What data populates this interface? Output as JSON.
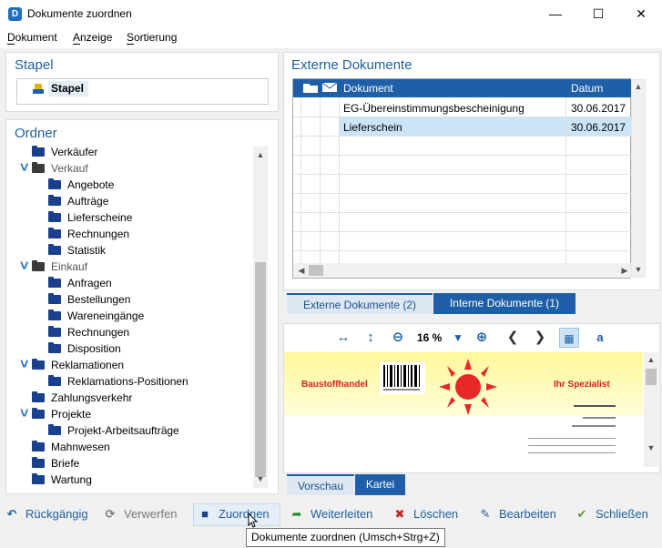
{
  "window": {
    "title": "Dokumente zuordnen",
    "controls": [
      "minimize",
      "maximize",
      "close"
    ]
  },
  "menu": {
    "items": [
      {
        "label": "Dokument",
        "accel": "D"
      },
      {
        "label": "Anzeige",
        "accel": "A"
      },
      {
        "label": "Sortierung",
        "accel": "S"
      }
    ]
  },
  "stapel": {
    "title": "Stapel",
    "item": "Stapel"
  },
  "ordner": {
    "title": "Ordner",
    "items": [
      {
        "label": "Verkäufer",
        "level": 0,
        "expanded": false
      },
      {
        "label": "Verkauf",
        "level": 0,
        "expanded": true,
        "grey": true
      },
      {
        "label": "Angebote",
        "level": 1
      },
      {
        "label": "Aufträge",
        "level": 1
      },
      {
        "label": "Lieferscheine",
        "level": 1
      },
      {
        "label": "Rechnungen",
        "level": 1
      },
      {
        "label": "Statistik",
        "level": 1
      },
      {
        "label": "Einkauf",
        "level": 0,
        "expanded": true,
        "grey": true
      },
      {
        "label": "Anfragen",
        "level": 1
      },
      {
        "label": "Bestellungen",
        "level": 1
      },
      {
        "label": "Wareneingänge",
        "level": 1
      },
      {
        "label": "Rechnungen",
        "level": 1
      },
      {
        "label": "Disposition",
        "level": 1
      },
      {
        "label": "Reklamationen",
        "level": 0,
        "expanded": true
      },
      {
        "label": "Reklamations-Positionen",
        "level": 1
      },
      {
        "label": "Zahlungsverkehr",
        "level": 0
      },
      {
        "label": "Projekte",
        "level": 0,
        "expanded": true
      },
      {
        "label": "Projekt-Arbeitsaufträge",
        "level": 1
      },
      {
        "label": "Mahnwesen",
        "level": 0
      },
      {
        "label": "Briefe",
        "level": 0
      },
      {
        "label": "Wartung",
        "level": 0
      }
    ]
  },
  "externe": {
    "title": "Externe Dokumente",
    "columns": {
      "dokument": "Dokument",
      "datum": "Datum"
    },
    "rows": [
      {
        "dokument": "EG-Übereinstimmungsbescheinigung",
        "datum": "30.06.2017",
        "selected": false
      },
      {
        "dokument": "Lieferschein",
        "datum": "30.06.2017",
        "selected": true
      }
    ]
  },
  "doc_tabs": [
    {
      "label": "Externe Dokumente (2)",
      "active": true
    },
    {
      "label": "Interne Dokumente (1)",
      "active": false
    }
  ],
  "preview": {
    "zoom": "16 %",
    "doc_left": "Baustoffhandel",
    "doc_right": "Ihr Spezialist"
  },
  "preview_tabs": [
    {
      "label": "Vorschau",
      "active": true
    },
    {
      "label": "Kartei",
      "active": false
    }
  ],
  "toolbar": {
    "undo": "Rückgängig",
    "discard": "Verwerfen",
    "assign": "Zuordnen",
    "forward": "Weiterleiten",
    "delete": "Löschen",
    "edit": "Bearbeiten",
    "close": "Schließen"
  },
  "tooltip": "Dokumente zuordnen (Umsch+Strg+Z)",
  "colors": {
    "accent": "#1e5fa8",
    "title": "#1f5f9f",
    "selection": "#cce4f7"
  }
}
